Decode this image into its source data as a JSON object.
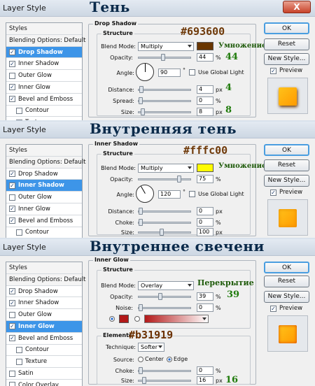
{
  "window_title": "Layer Style",
  "close_label": "X",
  "colors": {
    "shadow": "#693600",
    "inner_shadow": "#fffc00",
    "inner_glow": "#b31919",
    "selected_item": "#3d95e8"
  },
  "panels": [
    {
      "heading": "Тень",
      "annot_color": "#693600",
      "annot_mode": "Умножение",
      "annot_values": {
        "opacity": "44",
        "distance": "4",
        "size": "8"
      },
      "style_list": [
        {
          "label": "Styles",
          "type": "head"
        },
        {
          "label": "Blending Options: Default",
          "type": "head"
        },
        {
          "label": "Drop Shadow",
          "checked": true,
          "selected": true
        },
        {
          "label": "Inner Shadow",
          "checked": true
        },
        {
          "label": "Outer Glow",
          "checked": false
        },
        {
          "label": "Inner Glow",
          "checked": true
        },
        {
          "label": "Bevel and Emboss",
          "checked": true
        },
        {
          "label": "Contour",
          "checked": false,
          "indent": true
        },
        {
          "label": "Texture",
          "checked": false,
          "indent": true
        }
      ],
      "group_title": "Drop Shadow",
      "sub_title": "Structure",
      "blend_mode_label": "Blend Mode:",
      "blend_mode": "Multiply",
      "opacity_label": "Opacity:",
      "opacity": "44",
      "angle_label": "Angle:",
      "angle": "90",
      "global_light": "Use Global Light",
      "distance_label": "Distance:",
      "distance": "4",
      "spread_label": "Spread:",
      "spread": "0",
      "size_label": "Size:",
      "size": "8",
      "unit_px": "px",
      "unit_pct": "%",
      "degree": "°"
    },
    {
      "heading": "Внутренняя тень",
      "annot_color": "#fffc00",
      "annot_mode": "Умножение",
      "group_title": "Inner Shadow",
      "sub_title": "Structure",
      "blend_mode_label": "Blend Mode:",
      "blend_mode": "Multiply",
      "opacity_label": "Opacity:",
      "opacity": "75",
      "angle_label": "Angle:",
      "angle": "120",
      "global_light": "Use Global Light",
      "distance_label": "Distance:",
      "distance": "0",
      "choke_label": "Choke:",
      "choke": "0",
      "size_label": "Size:",
      "size": "100",
      "style_list": [
        {
          "label": "Styles",
          "type": "head"
        },
        {
          "label": "Blending Options: Default",
          "type": "head"
        },
        {
          "label": "Drop Shadow",
          "checked": true
        },
        {
          "label": "Inner Shadow",
          "checked": true,
          "selected": true
        },
        {
          "label": "Outer Glow",
          "checked": false
        },
        {
          "label": "Inner Glow",
          "checked": true
        },
        {
          "label": "Bevel and Emboss",
          "checked": true
        },
        {
          "label": "Contour",
          "checked": false,
          "indent": true
        }
      ]
    },
    {
      "heading": "Внутреннее свечени",
      "annot_color": "#b31919",
      "annot_mode": "Перекрытие",
      "annot_values": {
        "opacity": "39",
        "size": "16"
      },
      "group_title": "Inner Glow",
      "sub_title": "Structure",
      "elements_title": "Elements",
      "blend_mode_label": "Blend Mode:",
      "blend_mode": "Overlay",
      "opacity_label": "Opacity:",
      "opacity": "39",
      "noise_label": "Noise:",
      "noise": "0",
      "technique_label": "Technique:",
      "technique": "Softer",
      "source_label": "Source:",
      "source_center": "Center",
      "source_edge": "Edge",
      "choke_label": "Choke:",
      "choke": "0",
      "size_label": "Size:",
      "size": "16",
      "style_list": [
        {
          "label": "Styles",
          "type": "head"
        },
        {
          "label": "Blending Options: Default",
          "type": "head"
        },
        {
          "label": "Drop Shadow",
          "checked": true
        },
        {
          "label": "Inner Shadow",
          "checked": true
        },
        {
          "label": "Outer Glow",
          "checked": false
        },
        {
          "label": "Inner Glow",
          "checked": true,
          "selected": true
        },
        {
          "label": "Bevel and Emboss",
          "checked": true
        },
        {
          "label": "Contour",
          "checked": false,
          "indent": true
        },
        {
          "label": "Texture",
          "checked": false,
          "indent": true
        },
        {
          "label": "Satin",
          "checked": false
        },
        {
          "label": "Color Overlay",
          "checked": false
        }
      ]
    }
  ],
  "buttons": {
    "ok": "OK",
    "reset": "Reset",
    "new_style": "New Style...",
    "preview": "Preview"
  }
}
